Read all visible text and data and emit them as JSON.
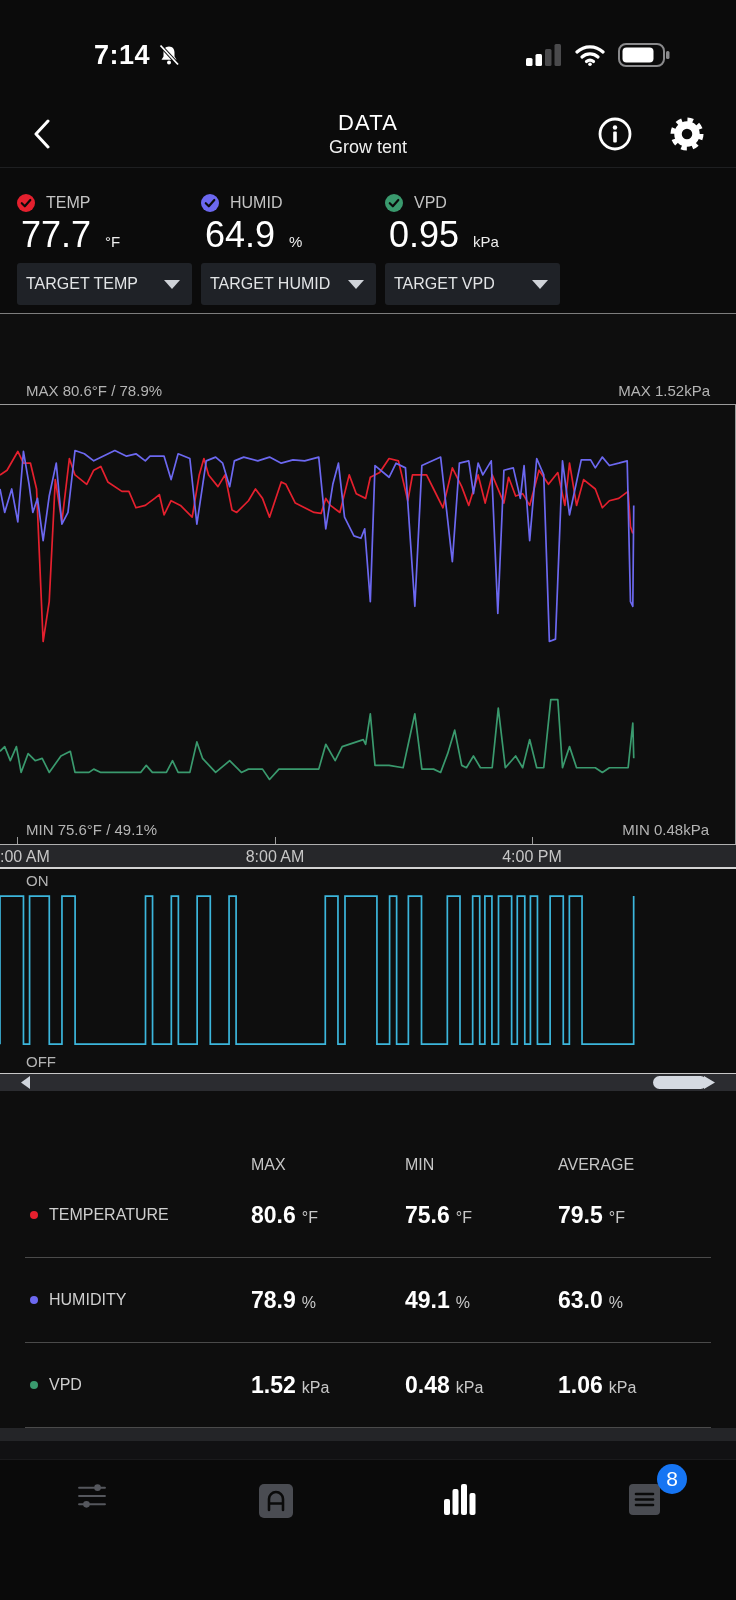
{
  "status_bar": {
    "time": "7:14"
  },
  "header": {
    "title": "DATA",
    "subtitle": "Grow tent"
  },
  "sensors": [
    {
      "label": "TEMP",
      "checked": true,
      "color": "#e5202e",
      "value": "77.7",
      "unit": "°F",
      "dropdown": "TARGET TEMP"
    },
    {
      "label": "HUMID",
      "checked": true,
      "color": "#6c68f0",
      "value": "64.9",
      "unit": "%",
      "dropdown": "TARGET HUMID"
    },
    {
      "label": "VPD",
      "checked": true,
      "color": "#3a9a6e",
      "value": "0.95",
      "unit": "kPa",
      "dropdown": "TARGET VPD"
    }
  ],
  "chart": {
    "max_left": "MAX 80.6°F / 78.9%",
    "max_right": "MAX 1.52kPa",
    "min_left": "MIN 75.6°F / 49.1%",
    "min_right": "MIN 0.48kPa",
    "x_labels": [
      ":00 AM",
      "8:00 AM",
      "4:00 PM"
    ]
  },
  "state_chart": {
    "on_label": "ON",
    "off_label": "OFF"
  },
  "table": {
    "columns": [
      "MAX",
      "MIN",
      "AVERAGE"
    ],
    "rows": [
      {
        "name": "TEMPERATURE",
        "color": "#e5202e",
        "cells": [
          {
            "value": "80.6",
            "unit": "°F"
          },
          {
            "value": "75.6",
            "unit": "°F"
          },
          {
            "value": "79.5",
            "unit": "°F"
          }
        ]
      },
      {
        "name": "HUMIDITY",
        "color": "#6c68f0",
        "cells": [
          {
            "value": "78.9",
            "unit": "%"
          },
          {
            "value": "49.1",
            "unit": "%"
          },
          {
            "value": "63.0",
            "unit": "%"
          }
        ]
      },
      {
        "name": "VPD",
        "color": "#3a9a6e",
        "cells": [
          {
            "value": "1.52",
            "unit": "kPa"
          },
          {
            "value": "0.48",
            "unit": "kPa"
          },
          {
            "value": "1.06",
            "unit": "kPa"
          }
        ]
      }
    ]
  },
  "bottom_nav": [
    {
      "kind": "sliders",
      "selected": false
    },
    {
      "kind": "dome",
      "selected": false
    },
    {
      "kind": "chart",
      "selected": true
    },
    {
      "kind": "list",
      "selected": false,
      "badge": "8"
    }
  ]
}
